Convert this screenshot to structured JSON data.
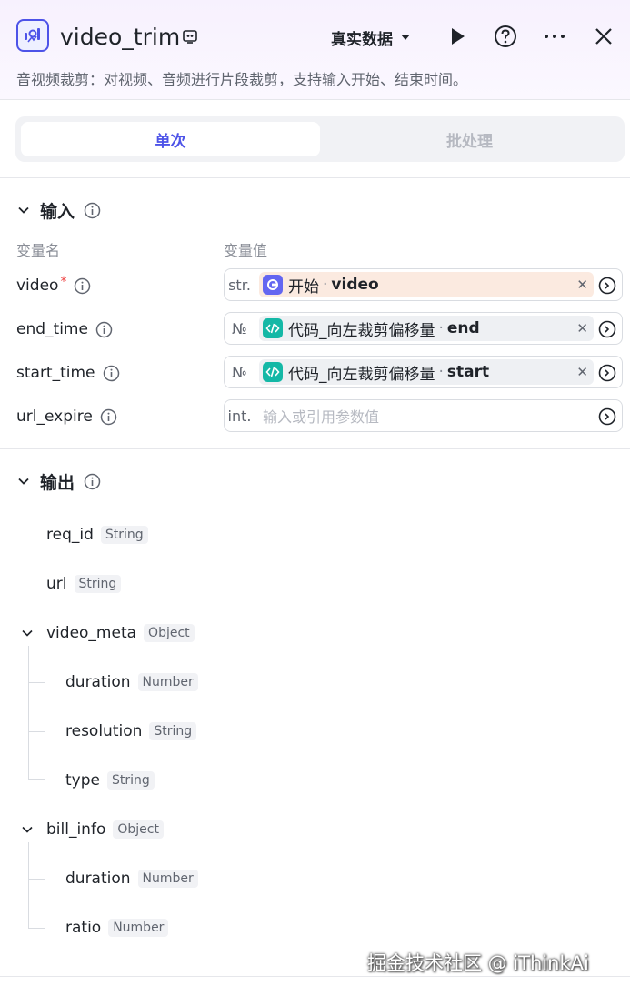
{
  "header": {
    "title": "video_trim",
    "env": "真实数据",
    "description": "音视频裁剪：对视频、音频进行片段裁剪，支持输入开始、结束时间。"
  },
  "tabs": [
    {
      "label": "单次",
      "active": true
    },
    {
      "label": "批处理",
      "active": false
    }
  ],
  "input": {
    "title": "输入",
    "col_name": "变量名",
    "col_value": "变量值",
    "params": [
      {
        "name": "video",
        "required": true,
        "type": "str.",
        "ref_node": "开始",
        "ref_var": "video",
        "ref_sep": "·"
      },
      {
        "name": "end_time",
        "required": false,
        "type": "№",
        "ref_node": "代码_向左裁剪偏移量",
        "ref_var": "end",
        "ref_sep": "·"
      },
      {
        "name": "start_time",
        "required": false,
        "type": "№",
        "ref_node": "代码_向左裁剪偏移量",
        "ref_var": "start",
        "ref_sep": "·"
      },
      {
        "name": "url_expire",
        "required": false,
        "type": "int.",
        "placeholder": "输入或引用参数值"
      }
    ]
  },
  "output": {
    "title": "输出",
    "fields": [
      {
        "name": "req_id",
        "type": "String"
      },
      {
        "name": "url",
        "type": "String"
      },
      {
        "name": "video_meta",
        "type": "Object",
        "children": [
          {
            "name": "duration",
            "type": "Number"
          },
          {
            "name": "resolution",
            "type": "String"
          },
          {
            "name": "type",
            "type": "String"
          }
        ]
      },
      {
        "name": "bill_info",
        "type": "Object",
        "children": [
          {
            "name": "duration",
            "type": "Number"
          },
          {
            "name": "ratio",
            "type": "Number"
          }
        ]
      }
    ]
  },
  "watermark": "掘金技术社区 @ iThinkAi",
  "colors": {
    "accent": "#4d53e8",
    "code_icon": "#14b8a6",
    "start_icon": "#6366f1",
    "ref_orange_bg": "#fbeae0"
  }
}
